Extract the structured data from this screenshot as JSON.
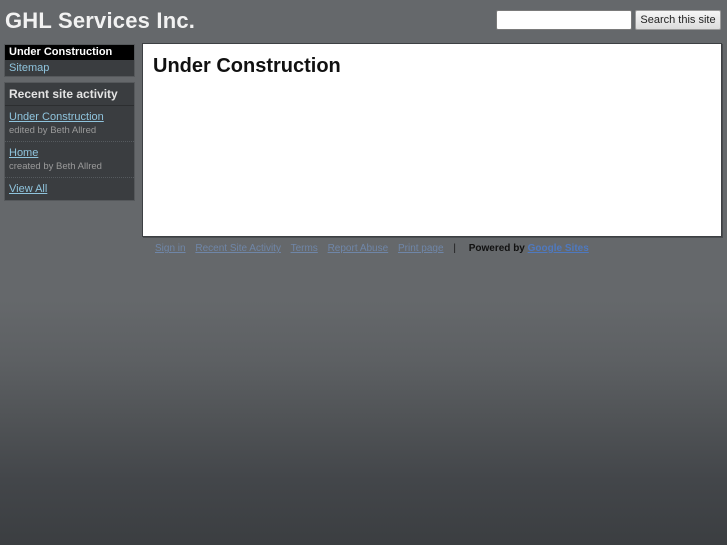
{
  "header": {
    "site_title": "GHL Services Inc.",
    "search_placeholder": "",
    "search_value": "",
    "search_button_label": "Search this site"
  },
  "sidebar": {
    "nav_items": [
      {
        "label": "Under Construction",
        "active": true
      },
      {
        "label": "Sitemap",
        "active": false
      }
    ],
    "recent_activity": {
      "title": "Recent site activity",
      "items": [
        {
          "link": "Under Construction",
          "meta": "edited by Beth Allred"
        },
        {
          "link": "Home",
          "meta": "created by Beth Allred"
        }
      ],
      "view_all_label": "View All"
    }
  },
  "main": {
    "page_title": "Under Construction"
  },
  "footer": {
    "links": [
      "Sign in",
      "Recent Site Activity",
      "Terms",
      "Report Abuse",
      "Print page"
    ],
    "separator": "|",
    "powered_by": "Powered by",
    "powered_link": "Google Sites"
  },
  "colors": {
    "link": "#8fc4dd",
    "nav_active_bg": "#000000",
    "panel_bg": "#3a3d40",
    "page_bg": "#65686b",
    "footer_link": "#6f86a8",
    "google_sites_link": "#4f79bf"
  }
}
